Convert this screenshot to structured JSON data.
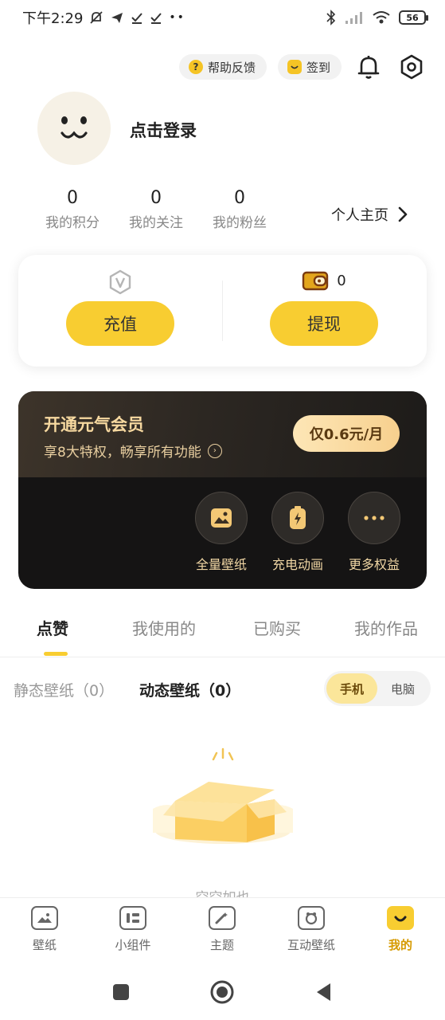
{
  "status_bar": {
    "time": "下午2:29",
    "battery": "56"
  },
  "top_actions": {
    "help_label": "帮助反馈",
    "help_badge": "?",
    "signin_label": "签到"
  },
  "profile": {
    "login_text": "点击登录"
  },
  "stats": [
    {
      "value": "0",
      "label": "我的积分"
    },
    {
      "value": "0",
      "label": "我的关注"
    },
    {
      "value": "0",
      "label": "我的粉丝"
    }
  ],
  "homepage_link": "个人主页",
  "wallet": {
    "recharge_label": "充值",
    "withdraw_label": "提现",
    "balance": "0"
  },
  "vip": {
    "title": "开通元气会员",
    "subtitle": "享8大特权，畅享所有功能",
    "price_label": "仅0.6元/月",
    "perks": [
      {
        "label": "全量壁纸"
      },
      {
        "label": "充电动画"
      },
      {
        "label": "更多权益"
      }
    ]
  },
  "tabs": [
    {
      "label": "点赞"
    },
    {
      "label": "我使用的"
    },
    {
      "label": "已购买"
    },
    {
      "label": "我的作品"
    }
  ],
  "filters": {
    "static_label": "静态壁纸（0）",
    "dynamic_label": "动态壁纸（0）",
    "phone_label": "手机",
    "pc_label": "电脑"
  },
  "empty_text": "空空如也",
  "bottom_nav": [
    {
      "label": "壁纸"
    },
    {
      "label": "小组件"
    },
    {
      "label": "主题"
    },
    {
      "label": "互动壁纸"
    },
    {
      "label": "我的"
    }
  ],
  "colors": {
    "accent": "#f8cd31",
    "accent_text": "#d69a00",
    "vip_gold": "#f7d9a0"
  }
}
